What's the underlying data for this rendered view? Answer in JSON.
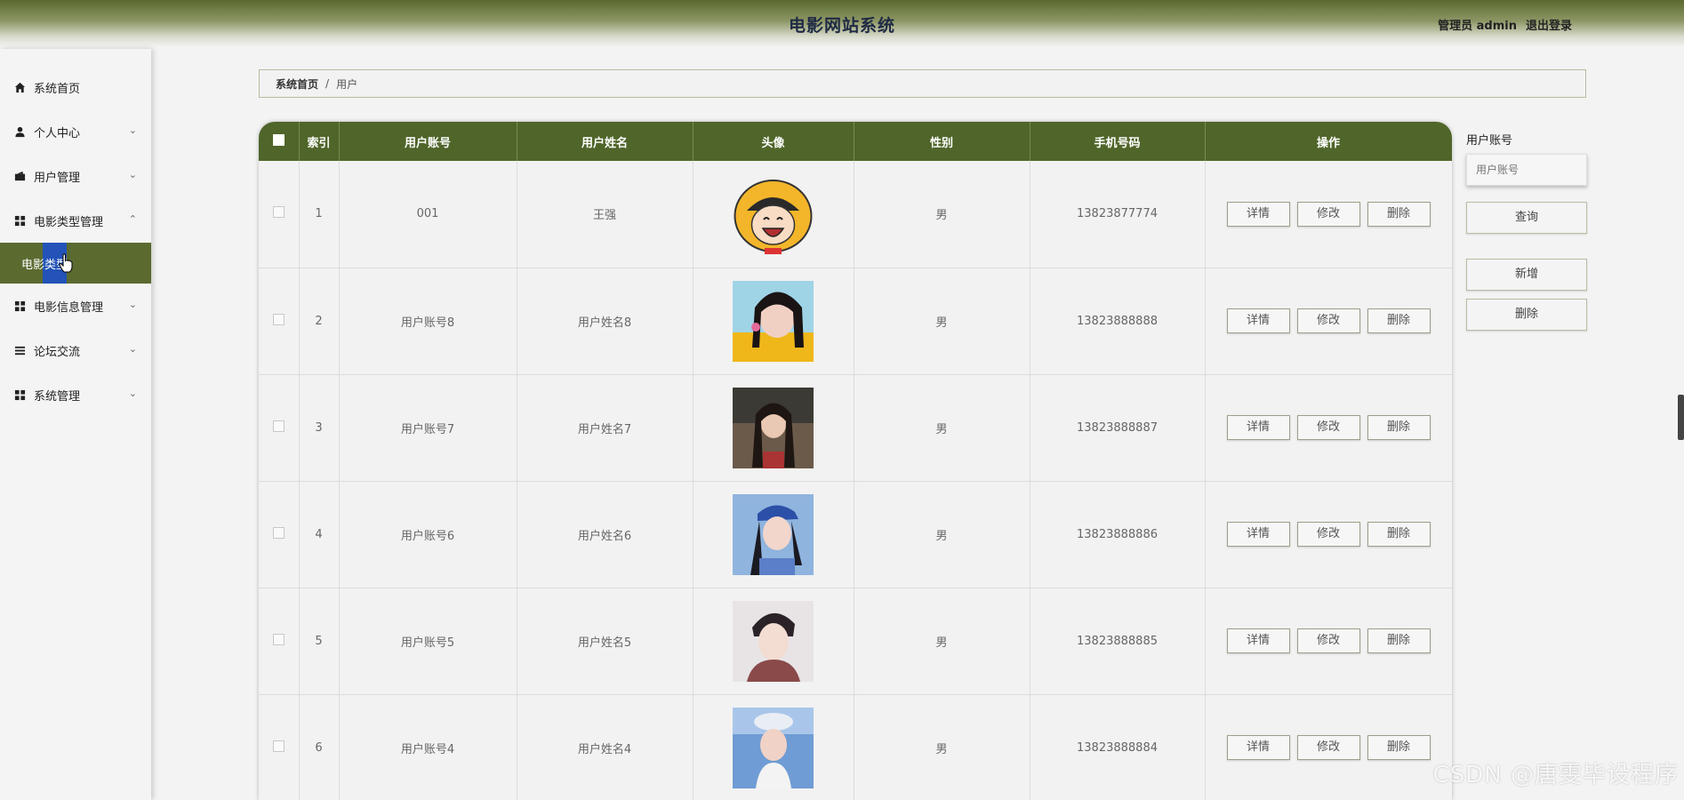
{
  "header": {
    "title": "电影网站系统",
    "user": "管理员 admin",
    "logout": "退出登录"
  },
  "sidebar": {
    "items": [
      {
        "label": "系统首页",
        "icon": "home-icon",
        "expandable": false
      },
      {
        "label": "个人中心",
        "icon": "person-icon",
        "expandable": true
      },
      {
        "label": "用户管理",
        "icon": "wallet-icon",
        "expandable": true
      },
      {
        "label": "电影类型管理",
        "icon": "grid-icon",
        "expandable": true,
        "expanded": true
      },
      {
        "label": "电影信息管理",
        "icon": "grid-icon",
        "expandable": true
      },
      {
        "label": "论坛交流",
        "icon": "list-icon",
        "expandable": true
      },
      {
        "label": "系统管理",
        "icon": "grid-icon",
        "expandable": true
      }
    ],
    "subitem": "电影类型",
    "chevron_down": "⌄",
    "chevron_up": "⌃"
  },
  "breadcrumb": {
    "home": "系统首页",
    "sep": "/",
    "current": "用户"
  },
  "table": {
    "columns": [
      "",
      "索引",
      "用户账号",
      "用户姓名",
      "头像",
      "性别",
      "手机号码",
      "操作"
    ],
    "rows": [
      {
        "index": "1",
        "account": "001",
        "name": "王强",
        "avatar": "cartoon-avatar",
        "gender": "男",
        "phone": "13823877774"
      },
      {
        "index": "2",
        "account": "用户账号8",
        "name": "用户姓名8",
        "avatar": "photo-avatar",
        "gender": "男",
        "phone": "13823888888"
      },
      {
        "index": "3",
        "account": "用户账号7",
        "name": "用户姓名7",
        "avatar": "photo-avatar",
        "gender": "男",
        "phone": "13823888887"
      },
      {
        "index": "4",
        "account": "用户账号6",
        "name": "用户姓名6",
        "avatar": "photo-avatar",
        "gender": "男",
        "phone": "13823888886"
      },
      {
        "index": "5",
        "account": "用户账号5",
        "name": "用户姓名5",
        "avatar": "photo-avatar",
        "gender": "男",
        "phone": "13823888885"
      },
      {
        "index": "6",
        "account": "用户账号4",
        "name": "用户姓名4",
        "avatar": "photo-avatar",
        "gender": "男",
        "phone": "13823888884"
      }
    ],
    "actions": {
      "detail": "详情",
      "edit": "修改",
      "delete": "删除"
    }
  },
  "search": {
    "label": "用户账号",
    "placeholder": "用户账号",
    "query_button": "查询",
    "add_button": "新增",
    "delete_button": "删除"
  },
  "watermark": "CSDN @唐雯毕设程序",
  "colors": {
    "primary": "#4f6529",
    "sidebar_active": "#5b6b30"
  }
}
